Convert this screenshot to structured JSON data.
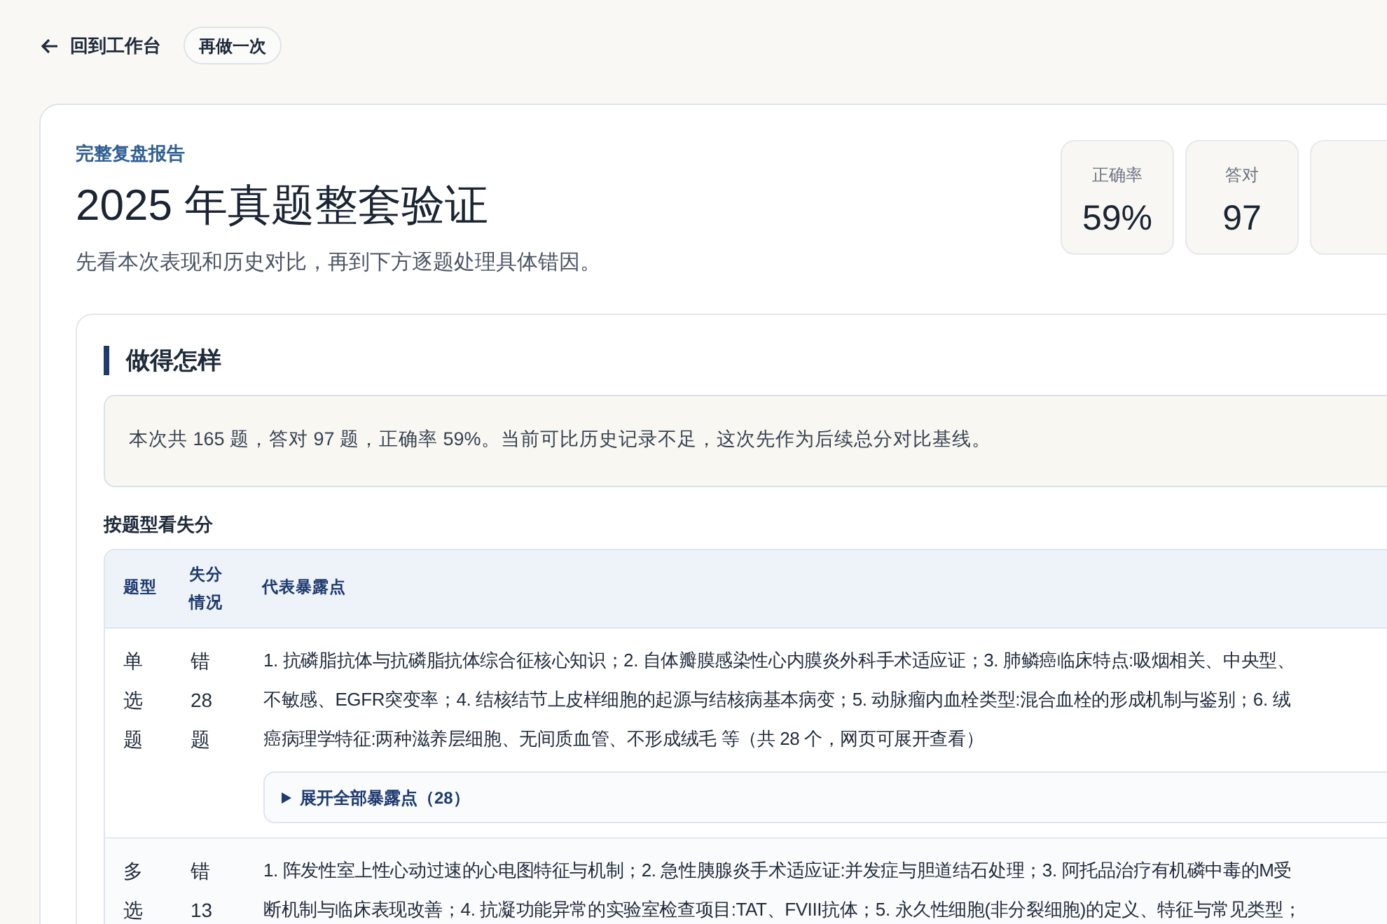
{
  "top_bar": {
    "back_link": "回到工作台",
    "redo_button": "再做一次"
  },
  "report": {
    "eyebrow": "完整复盘报告",
    "title": "2025 年真题整套验证",
    "subtitle": "先看本次表现和历史对比，再到下方逐题处理具体错因。",
    "stats": [
      {
        "label": "正确率",
        "value": "59%"
      },
      {
        "label": "答对",
        "value": "97"
      }
    ],
    "section": {
      "heading": "做得怎样",
      "summary": "本次共 165 题，答对 97 题，正确率 59%。当前可比历史记录不足，这次先作为后续总分对比基线。",
      "table_title": "按题型看失分",
      "table": {
        "columns": [
          "题型",
          "失分情况",
          "代表暴露点"
        ],
        "rows": [
          {
            "type": "单选题",
            "loss": "错 28 题",
            "points": [
              "1. 抗磷脂抗体与抗磷脂抗体综合征核心知识；2. 自体瓣膜感染性心内膜炎外科手术适应证；3. 肺鳞癌临床特点:吸烟相关、中央型、",
              "不敏感、EGFR突变率；4. 结核结节上皮样细胞的起源与结核病基本病变；5. 动脉瘤内血栓类型:混合血栓的形成机制与鉴别；6. 绒",
              "癌病理学特征:两种滋养层细胞、无间质血管、不形成绒毛 等（共 28 个，网页可展开查看）"
            ],
            "expand": "展开全部暴露点（28）"
          },
          {
            "type": "多选",
            "loss": "错 13",
            "points": [
              "1. 阵发性室上性心动过速的心电图特征与机制；2. 急性胰腺炎手术适应证:并发症与胆道结石处理；3. 阿托品治疗有机磷中毒的M受",
              "断机制与临床表现改善；4. 抗凝功能异常的实验室检查项目:TAT、FVIII抗体；5. 永久性细胞(非分裂细胞)的定义、特征与常见类型；"
            ]
          }
        ]
      }
    }
  }
}
